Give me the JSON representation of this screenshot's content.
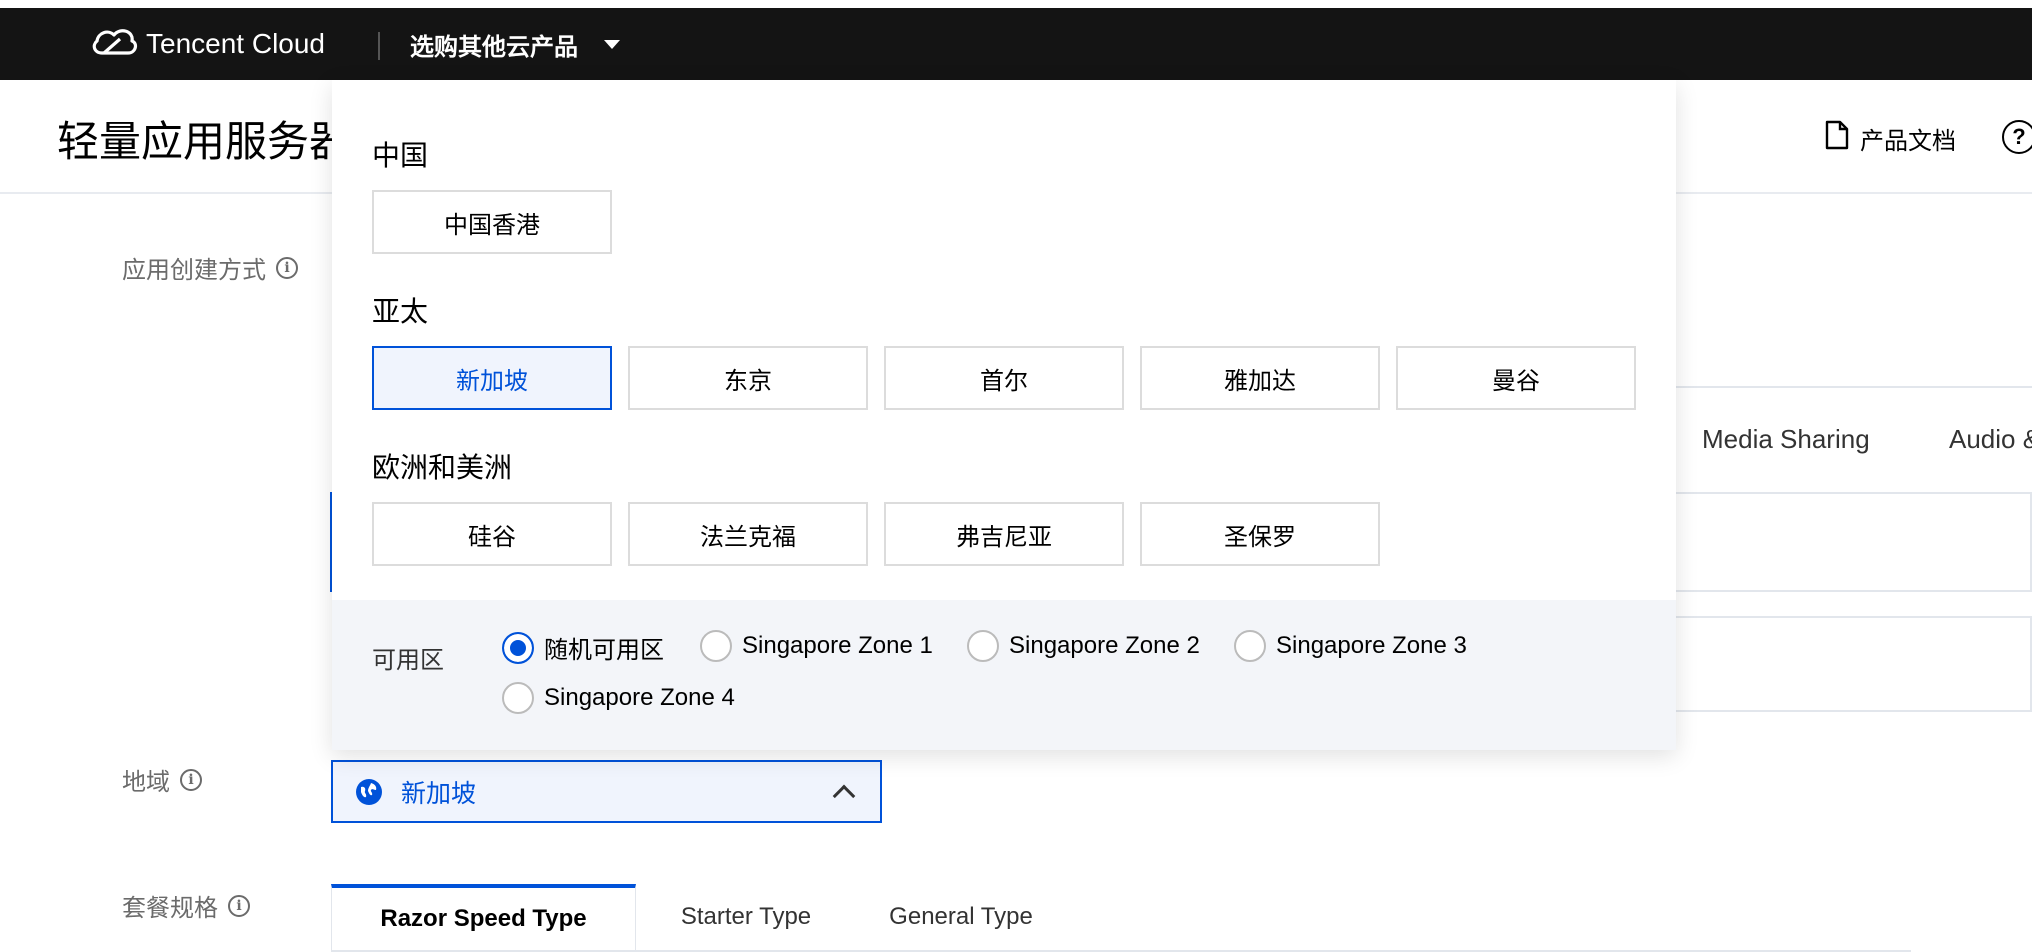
{
  "nav": {
    "brand": "Tencent Cloud",
    "product_switch": "选购其他云产品"
  },
  "header": {
    "title": "轻量应用服务器",
    "doc_link": "产品文档",
    "help": "?"
  },
  "form": {
    "create_method_label": "应用创建方式",
    "region_label": "地域",
    "spec_label": "套餐规格"
  },
  "background_tabs": [
    "Media Sharing",
    "Audio &"
  ],
  "region_panel": {
    "groups": [
      {
        "title": "中国",
        "options": [
          "中国香港"
        ]
      },
      {
        "title": "亚太",
        "options": [
          "新加坡",
          "东京",
          "首尔",
          "雅加达",
          "曼谷"
        ]
      },
      {
        "title": "欧洲和美洲",
        "options": [
          "硅谷",
          "法兰克福",
          "弗吉尼亚",
          "圣保罗"
        ]
      }
    ],
    "selected_region": "新加坡",
    "zone": {
      "label": "可用区",
      "options": [
        "随机可用区",
        "Singapore Zone 1",
        "Singapore Zone 2",
        "Singapore Zone 3",
        "Singapore Zone 4"
      ],
      "selected": "随机可用区"
    }
  },
  "region_select": {
    "value": "新加坡"
  },
  "spec_tabs": [
    "Razor Speed Type",
    "Starter Type",
    "General Type"
  ],
  "colors": {
    "accent": "#0052d9",
    "nav_bg": "#141414",
    "selected_bg": "#f0f4fd"
  }
}
